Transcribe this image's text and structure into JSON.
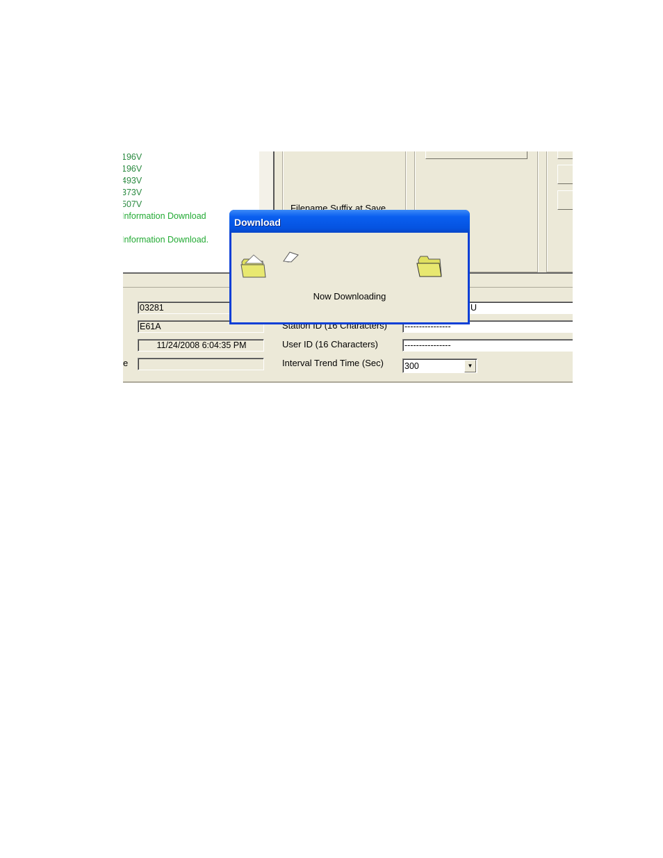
{
  "log": {
    "lines": [
      "196V",
      "196V",
      "493V",
      "373V",
      "507V",
      "Information Download",
      "",
      "Information Download."
    ]
  },
  "panel": {
    "filename_suffix_label": "Filename Suffix at Save",
    "station_id_label": "Station ID (16 Characters)",
    "user_id_label": "User ID (16 Characters)",
    "interval_label": "Interval Trend Time (Sec)",
    "left_label_fragment": "e",
    "field_1": "03281",
    "field_2": "E61A",
    "field_3": "11/24/2008 6:04:35 PM",
    "field_4": "",
    "right_field_1": "U",
    "station_id_value": "----------------",
    "user_id_value": "----------------",
    "interval_value": "300"
  },
  "dialog": {
    "title": "Download",
    "message": "Now Downloading",
    "icons": [
      "source-folder-icon",
      "flying-document-icon",
      "destination-folder-icon"
    ]
  },
  "colors": {
    "log_text": "#22aa33",
    "title_bar": "#0553e0",
    "window_bg": "#ece9d8"
  }
}
